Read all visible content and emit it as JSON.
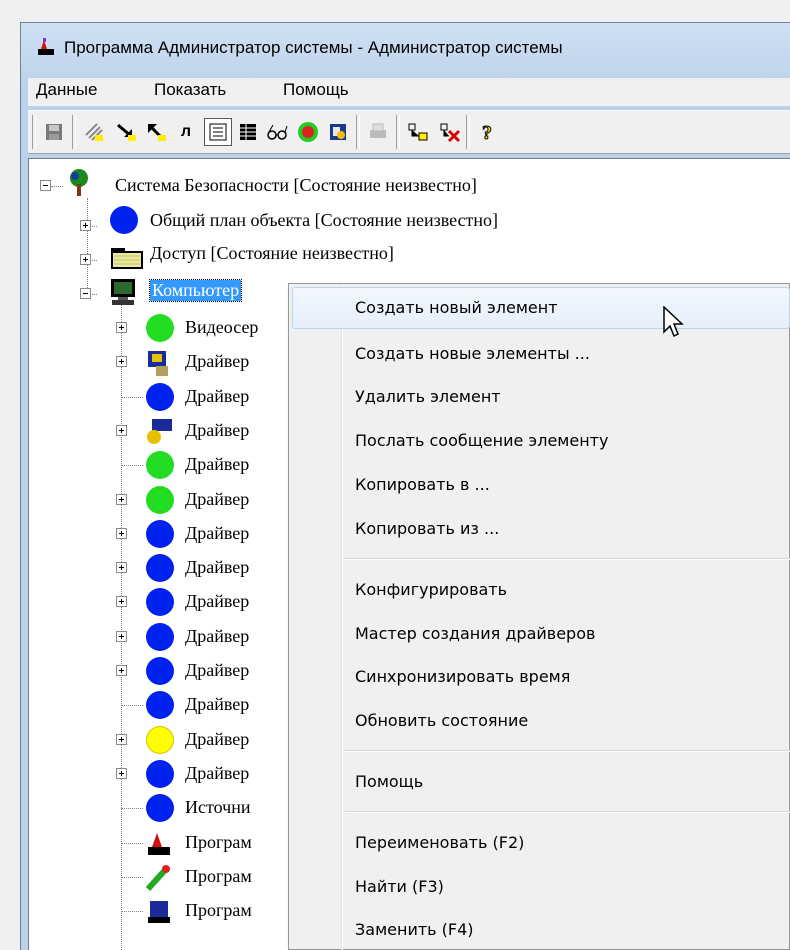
{
  "window": {
    "title": "Программа Администратор системы - Администратор системы"
  },
  "menu": [
    "Данные",
    "Показать",
    "Помощь"
  ],
  "toolbar_icons": [
    "save-icon",
    "grid-icon",
    "arrow-down-right-icon",
    "arrow-up-left-icon",
    "l-tool-icon",
    "properties-icon",
    "table-icon",
    "glasses-icon",
    "alarm-icon",
    "book-icon",
    "print-icon",
    "connect-icon",
    "disconnect-icon",
    "help-icon"
  ],
  "tree": {
    "root": "Система Безопасности [Состояние неизвестно]",
    "level1": [
      "Общий план объекта [Состояние неизвестно]",
      "Доступ [Состояние неизвестно]",
      "Компьютер"
    ],
    "children": [
      {
        "label": "Видеосер",
        "icon_color": "#22dd22",
        "expand": true
      },
      {
        "label": "Драйвер",
        "icon_color": "driver-icon",
        "expand": true
      },
      {
        "label": "Драйвер",
        "icon_color": "#0022ee",
        "expand": false
      },
      {
        "label": "Драйвер",
        "icon_color": "driver2-icon",
        "expand": true
      },
      {
        "label": "Драйвер",
        "icon_color": "#22dd22",
        "expand": false
      },
      {
        "label": "Драйвер",
        "icon_color": "#22dd22",
        "expand": true
      },
      {
        "label": "Драйвер",
        "icon_color": "#0022ee",
        "expand": true
      },
      {
        "label": "Драйвер",
        "icon_color": "#0022ee",
        "expand": true
      },
      {
        "label": "Драйвер",
        "icon_color": "#0022ee",
        "expand": true
      },
      {
        "label": "Драйвер",
        "icon_color": "#0022ee",
        "expand": true
      },
      {
        "label": "Драйвер",
        "icon_color": "#0022ee",
        "expand": true
      },
      {
        "label": "Драйвер",
        "icon_color": "#0022ee",
        "expand": false
      },
      {
        "label": "Драйвер",
        "icon_color": "#ffff00",
        "expand": true
      },
      {
        "label": "Драйвер",
        "icon_color": "#0022ee",
        "expand": true
      },
      {
        "label": "Источни",
        "icon_color": "#0022ee",
        "expand": false
      },
      {
        "label": "Програм",
        "icon_color": "admin-app-icon",
        "expand": false
      },
      {
        "label": "Програм",
        "icon_color": "pen-app-icon",
        "expand": false
      },
      {
        "label": "Програм",
        "icon_color": "monitor-app-icon",
        "expand": false
      }
    ]
  },
  "context_menu": {
    "groups": [
      [
        "Создать новый элемент",
        "Создать новые элементы ...",
        "Удалить элемент",
        "Послать сообщение элементу",
        "Копировать в ...",
        "Копировать из ..."
      ],
      [
        "Конфигурировать",
        "Мастер создания драйверов",
        "Синхронизировать время",
        "Обновить состояние"
      ],
      [
        "Помощь"
      ],
      [
        "Переименовать (F2)",
        "Найти (F3)",
        "Заменить (F4)"
      ]
    ]
  },
  "colors": {
    "selection": "#3399ff",
    "green": "#22dd22",
    "blue": "#0022ee",
    "yellow": "#ffff00"
  }
}
